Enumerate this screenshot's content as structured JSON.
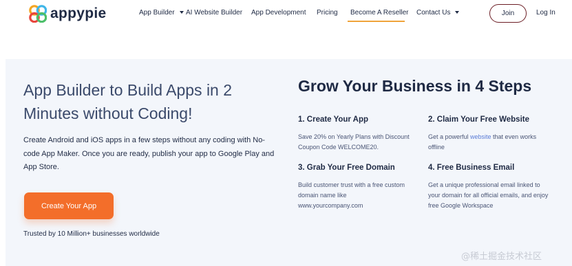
{
  "brand": {
    "name": "appypie"
  },
  "nav": {
    "items": [
      {
        "label": "App Builder",
        "dropdown": true
      },
      {
        "label": "AI Website Builder",
        "dropdown": false
      },
      {
        "label": "App Development",
        "dropdown": false
      },
      {
        "label": "Pricing",
        "dropdown": false
      },
      {
        "label": "Become A Reseller",
        "dropdown": false,
        "active": true
      },
      {
        "label": "Contact Us",
        "dropdown": true
      }
    ],
    "join_label": "Join",
    "login_label": "Log In"
  },
  "hero": {
    "title": "App Builder to Build Apps in 2 Minutes without Coding!",
    "description": "Create Android and iOS apps in a few steps without any coding with No-code App Maker. Once you are ready, publish your app to Google Play and App Store.",
    "cta_label": "Create Your App",
    "trusted_text": "Trusted by 10 Million+ businesses worldwide"
  },
  "steps": {
    "title": "Grow Your Business in 4 Steps",
    "items": [
      {
        "heading": "1. Create Your App",
        "text": "Save 20% on Yearly Plans with Discount Coupon Code WELCOME20."
      },
      {
        "heading": "2. Claim Your Free Website",
        "text_before": "Get a powerful ",
        "link": "website",
        "text_after": " that even works offline"
      },
      {
        "heading": "3. Grab Your Free Domain",
        "text": "Build customer trust with a free custom domain name like www.yourcompany.com"
      },
      {
        "heading": "4. Free Business Email",
        "text": "Get a unique professional email linked to your domain for all official emails, and enjoy free Google Workspace"
      }
    ]
  },
  "watermark": "@稀土掘金技术社区",
  "colors": {
    "cta": "#f36e2a",
    "active_underline": "#f0a33a",
    "join_border": "#6b1d24",
    "hero_bg": "#f3f6fb",
    "link": "#5a7bd6"
  }
}
